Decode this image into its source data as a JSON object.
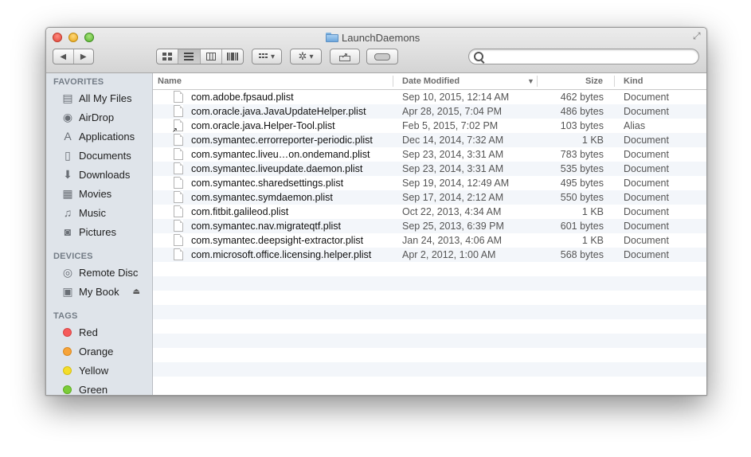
{
  "window": {
    "title": "LaunchDaemons"
  },
  "toolbar": {
    "back_label": "◀",
    "forward_label": "▶",
    "views": [
      "icon-view",
      "list-view",
      "column-view",
      "coverflow-view"
    ],
    "arrange_label": "▾",
    "action_label": "▾"
  },
  "search": {
    "placeholder": "",
    "value": ""
  },
  "sidebar": {
    "favorites_header": "FAVORITES",
    "favorites": [
      {
        "label": "All My Files",
        "icon": "all-files-icon"
      },
      {
        "label": "AirDrop",
        "icon": "airdrop-icon"
      },
      {
        "label": "Applications",
        "icon": "applications-icon"
      },
      {
        "label": "Documents",
        "icon": "documents-icon"
      },
      {
        "label": "Downloads",
        "icon": "downloads-icon"
      },
      {
        "label": "Movies",
        "icon": "movies-icon"
      },
      {
        "label": "Music",
        "icon": "music-icon"
      },
      {
        "label": "Pictures",
        "icon": "pictures-icon"
      }
    ],
    "devices_header": "DEVICES",
    "devices": [
      {
        "label": "Remote Disc",
        "icon": "disc-icon"
      },
      {
        "label": "My Book",
        "icon": "drive-icon",
        "eject": "⏏"
      }
    ],
    "tags_header": "TAGS",
    "tags": [
      {
        "label": "Red",
        "color": "#f55b5b"
      },
      {
        "label": "Orange",
        "color": "#f7a43a"
      },
      {
        "label": "Yellow",
        "color": "#f4dd2b"
      },
      {
        "label": "Green",
        "color": "#7ccc3a"
      }
    ]
  },
  "columns": {
    "name": "Name",
    "date": "Date Modified",
    "size": "Size",
    "kind": "Kind",
    "sort_indicator": "▼"
  },
  "files": [
    {
      "name": "com.adobe.fpsaud.plist",
      "date": "Sep 10, 2015, 12:14 AM",
      "size": "462 bytes",
      "kind": "Document"
    },
    {
      "name": "com.oracle.java.JavaUpdateHelper.plist",
      "date": "Apr 28, 2015, 7:04 PM",
      "size": "486 bytes",
      "kind": "Document"
    },
    {
      "name": "com.oracle.java.Helper-Tool.plist",
      "date": "Feb 5, 2015, 7:02 PM",
      "size": "103 bytes",
      "kind": "Alias",
      "alias": true
    },
    {
      "name": "com.symantec.errorreporter-periodic.plist",
      "date": "Dec 14, 2014, 7:32 AM",
      "size": "1 KB",
      "kind": "Document"
    },
    {
      "name": "com.symantec.liveu…on.ondemand.plist",
      "date": "Sep 23, 2014, 3:31 AM",
      "size": "783 bytes",
      "kind": "Document"
    },
    {
      "name": "com.symantec.liveupdate.daemon.plist",
      "date": "Sep 23, 2014, 3:31 AM",
      "size": "535 bytes",
      "kind": "Document"
    },
    {
      "name": "com.symantec.sharedsettings.plist",
      "date": "Sep 19, 2014, 12:49 AM",
      "size": "495 bytes",
      "kind": "Document"
    },
    {
      "name": "com.symantec.symdaemon.plist",
      "date": "Sep 17, 2014, 2:12 AM",
      "size": "550 bytes",
      "kind": "Document"
    },
    {
      "name": "com.fitbit.galileod.plist",
      "date": "Oct 22, 2013, 4:34 AM",
      "size": "1 KB",
      "kind": "Document"
    },
    {
      "name": "com.symantec.nav.migrateqtf.plist",
      "date": "Sep 25, 2013, 6:39 PM",
      "size": "601 bytes",
      "kind": "Document"
    },
    {
      "name": "com.symantec.deepsight-extractor.plist",
      "date": "Jan 24, 2013, 4:06 AM",
      "size": "1 KB",
      "kind": "Document"
    },
    {
      "name": "com.microsoft.office.licensing.helper.plist",
      "date": "Apr 2, 2012, 1:00 AM",
      "size": "568 bytes",
      "kind": "Document"
    }
  ]
}
